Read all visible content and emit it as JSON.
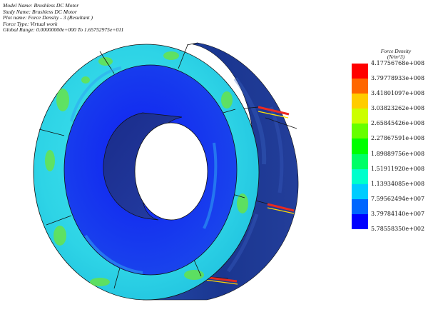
{
  "header": {
    "model_name": "Model Name: Brushless DC Motor",
    "study_name": "Study Name: Brushless DC Motor",
    "plot_name": "Plot name: Force Density  - 3 (Resultant )",
    "force_type": "Force Type: Virtual work",
    "global_range": "Global Range: 0.00000000e+000 To 1.65752975e+011"
  },
  "legend": {
    "title_line1": "Force Density",
    "title_line2": "(N/m^3)",
    "labels": [
      "4.17756768e+008",
      "3.79778933e+008",
      "3.41801097e+008",
      "3.03823262e+008",
      "2.65845426e+008",
      "2.27867591e+008",
      "1.89889756e+008",
      "1.51911920e+008",
      "1.13934085e+008",
      "7.59562494e+007",
      "3.79784140e+007",
      "5.78558350e+002"
    ],
    "colors": [
      "#ff0000",
      "#ff6600",
      "#ffcc00",
      "#ccff00",
      "#66ff00",
      "#00ff00",
      "#00ff66",
      "#00ffcc",
      "#00ccff",
      "#0066ff",
      "#0000ff"
    ]
  },
  "colors": {
    "outer_ring": "#33d6e6",
    "inner_disk": "#1530ee",
    "bore": "#1c2f96",
    "side_band": "#1d3a98",
    "hotspot": "#6fe636"
  }
}
